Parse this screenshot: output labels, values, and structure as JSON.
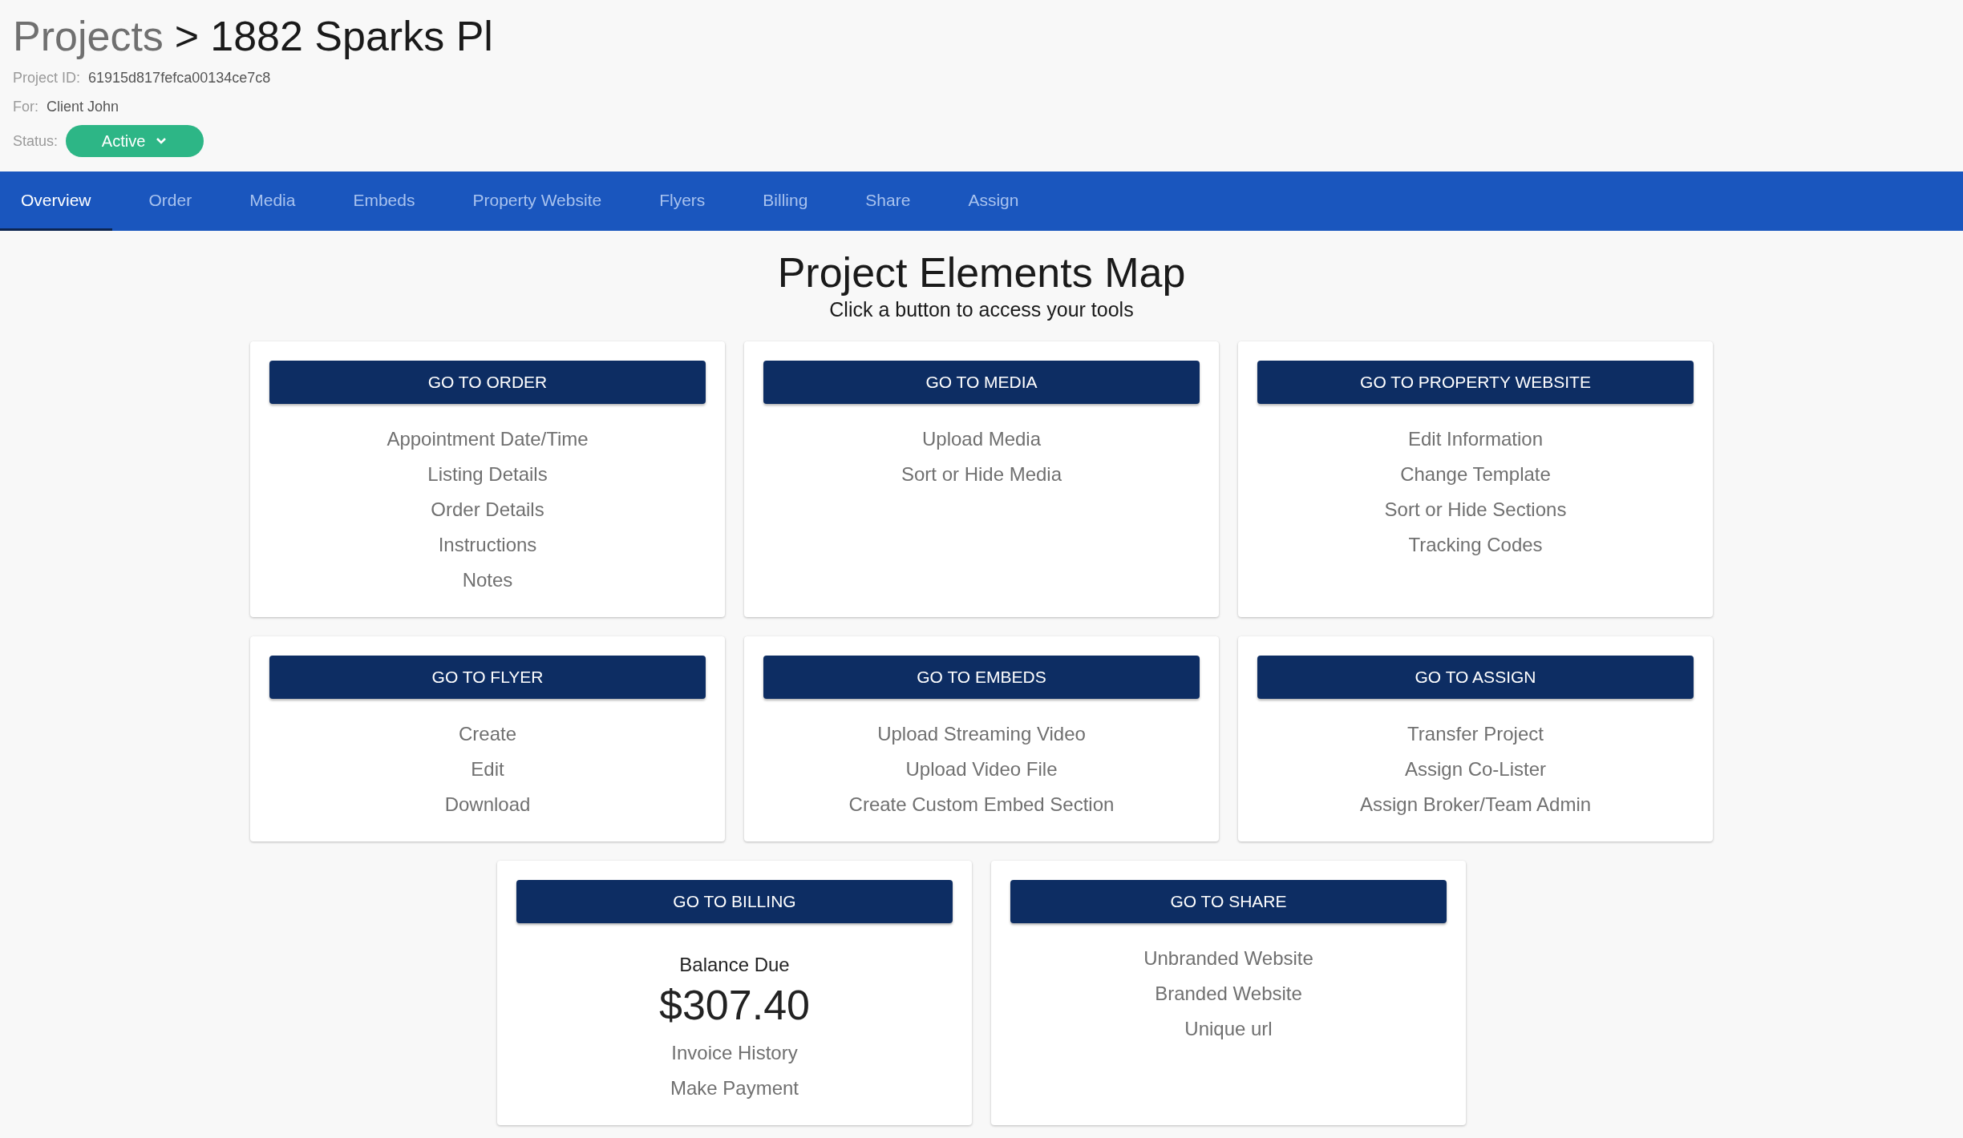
{
  "breadcrumb": {
    "parent": "Projects",
    "separator": ">",
    "current": "1882 Sparks Pl"
  },
  "meta": [
    {
      "label": "Project ID:",
      "value": "61915d817fefca00134ce7c8"
    },
    {
      "label": "For:",
      "value": "Client John"
    }
  ],
  "status": {
    "label": "Status:",
    "value": "Active"
  },
  "tabs": [
    {
      "label": "Overview",
      "selected": true
    },
    {
      "label": "Order",
      "selected": false
    },
    {
      "label": "Media",
      "selected": false
    },
    {
      "label": "Embeds",
      "selected": false
    },
    {
      "label": "Property Website",
      "selected": false
    },
    {
      "label": "Flyers",
      "selected": false
    },
    {
      "label": "Billing",
      "selected": false
    },
    {
      "label": "Share",
      "selected": false
    },
    {
      "label": "Assign",
      "selected": false
    }
  ],
  "heading": {
    "title": "Project Elements Map",
    "subtitle": "Click a button to access your tools"
  },
  "cards": [
    {
      "kind": "links",
      "button": "GO TO ORDER",
      "items": [
        "Appointment Date/Time",
        "Listing Details",
        "Order Details",
        "Instructions",
        "Notes"
      ]
    },
    {
      "kind": "links",
      "button": "GO TO MEDIA",
      "items": [
        "Upload Media",
        "Sort or Hide Media"
      ]
    },
    {
      "kind": "links",
      "button": "GO TO PROPERTY WEBSITE",
      "items": [
        "Edit Information",
        "Change Template",
        "Sort or Hide Sections",
        "Tracking Codes"
      ]
    },
    {
      "kind": "links",
      "button": "GO TO FLYER",
      "items": [
        "Create",
        "Edit",
        "Download"
      ]
    },
    {
      "kind": "links",
      "button": "GO TO EMBEDS",
      "items": [
        "Upload Streaming Video",
        "Upload Video File",
        "Create Custom Embed Section"
      ]
    },
    {
      "kind": "links",
      "button": "GO TO ASSIGN",
      "items": [
        "Transfer Project",
        "Assign Co-Lister",
        "Assign Broker/Team Admin"
      ]
    },
    {
      "kind": "billing",
      "button": "GO TO BILLING",
      "balance_label": "Balance Due",
      "balance": "$307.40",
      "items": [
        "Invoice History",
        "Make Payment"
      ]
    },
    {
      "kind": "links",
      "button": "GO TO SHARE",
      "items": [
        "Unbranded Website",
        "Branded Website",
        "Unique url"
      ]
    }
  ]
}
